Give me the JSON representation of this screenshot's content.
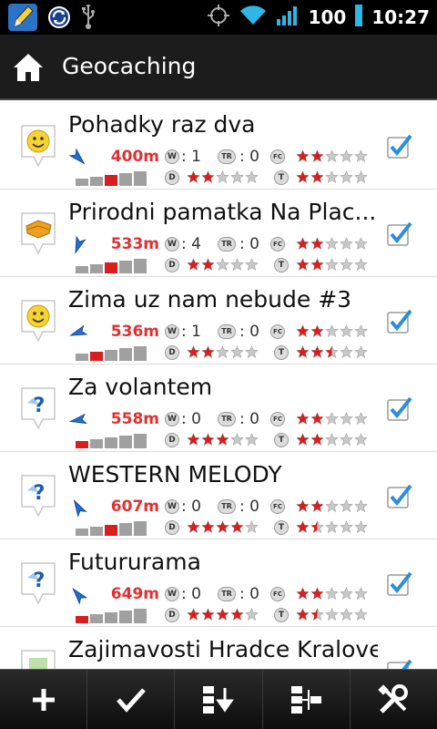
{
  "status": {
    "battery": "100",
    "time": "10:27"
  },
  "titlebar": {
    "title": "Geocaching"
  },
  "labels": {
    "watch": "W",
    "trackables": "TR",
    "favorites": "FC",
    "difficulty": "D",
    "terrain": "T"
  },
  "caches": [
    {
      "name": "Pohadky raz dva",
      "type": "event",
      "distance": "400m",
      "watch": ": 1",
      "tr": ": 0",
      "favorites": 2,
      "difficulty": 2,
      "terrain": 2,
      "size": 3,
      "arrow_angle": 135,
      "checked": true
    },
    {
      "name": "Prirodni pamatka Na Plac...",
      "type": "mystery-orange",
      "distance": "533m",
      "watch": ": 4",
      "tr": ": 0",
      "favorites": 2,
      "difficulty": 2,
      "terrain": 2,
      "size": 3,
      "arrow_angle": 200,
      "checked": true
    },
    {
      "name": "Zima uz nam nebude #3",
      "type": "event",
      "distance": "536m",
      "watch": ": 1",
      "tr": ": 0",
      "favorites": 2,
      "difficulty": 2,
      "terrain": 2.5,
      "size": 2,
      "arrow_angle": 250,
      "checked": true
    },
    {
      "name": "Za volantem",
      "type": "unknown",
      "distance": "558m",
      "watch": ": 0",
      "tr": ": 0",
      "favorites": 2,
      "difficulty": 3,
      "terrain": 2,
      "size": 1,
      "arrow_angle": 260,
      "checked": true
    },
    {
      "name": "WESTERN MELODY",
      "type": "unknown",
      "distance": "607m",
      "watch": ": 0",
      "tr": ": 0",
      "favorites": 2,
      "difficulty": 4,
      "terrain": 1.5,
      "size": 3,
      "arrow_angle": 330,
      "checked": true
    },
    {
      "name": "Futururama",
      "type": "unknown",
      "distance": "649m",
      "watch": ": 0",
      "tr": ": 0",
      "favorites": 2,
      "difficulty": 4,
      "terrain": 1.5,
      "size": 1,
      "arrow_angle": 320,
      "checked": true
    },
    {
      "name": "Zajimavosti Hradce Kralove",
      "type": "virtual",
      "distance": "",
      "watch": "",
      "tr": "",
      "favorites": 0,
      "difficulty": 0,
      "terrain": 0,
      "size": 0,
      "arrow_angle": 0,
      "checked": true
    }
  ],
  "colors": {
    "distance": "#e03030",
    "star_on": "#d81e1e",
    "star_off": "#c8c8c8",
    "check": "#2b8de0"
  },
  "toolbar": {
    "buttons": [
      "plus-icon",
      "check-icon",
      "sort-icon",
      "tree-icon",
      "tools-icon"
    ]
  }
}
